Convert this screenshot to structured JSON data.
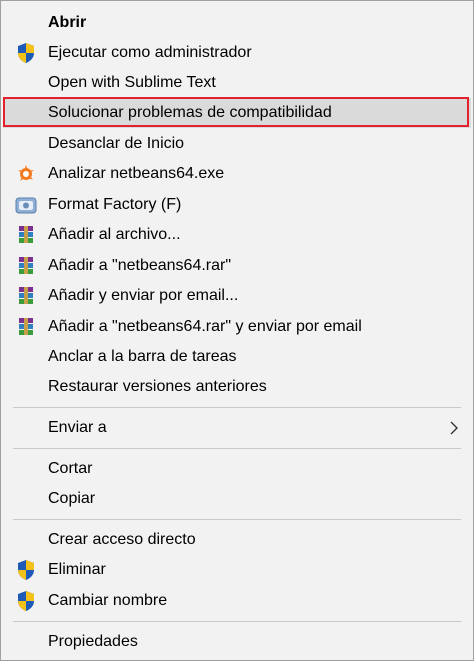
{
  "menu": {
    "items": [
      {
        "label": "Abrir",
        "icon": "none"
      },
      {
        "label": "Ejecutar como administrador",
        "icon": "shield-icon"
      },
      {
        "label": "Open with Sublime Text",
        "icon": "none"
      },
      {
        "label": "Solucionar problemas de compatibilidad",
        "icon": "none"
      },
      {
        "label": "Desanclar de Inicio",
        "icon": "none"
      },
      {
        "label": "Analizar netbeans64.exe",
        "icon": "avast-icon"
      },
      {
        "label": "Format Factory (F)",
        "icon": "format-factory-icon"
      },
      {
        "label": "Añadir al archivo...",
        "icon": "winrar-icon"
      },
      {
        "label": "Añadir a \"netbeans64.rar\"",
        "icon": "winrar-icon"
      },
      {
        "label": "Añadir y enviar por email...",
        "icon": "winrar-icon"
      },
      {
        "label": "Añadir a \"netbeans64.rar\" y enviar por email",
        "icon": "winrar-icon"
      },
      {
        "label": "Anclar a la barra de tareas",
        "icon": "none"
      },
      {
        "label": "Restaurar versiones anteriores",
        "icon": "none"
      },
      {
        "label": "Enviar a",
        "icon": "none",
        "submenu": "chevron-right-icon"
      },
      {
        "label": "Cortar",
        "icon": "none"
      },
      {
        "label": "Copiar",
        "icon": "none"
      },
      {
        "label": "Crear acceso directo",
        "icon": "none"
      },
      {
        "label": "Eliminar",
        "icon": "shield-icon"
      },
      {
        "label": "Cambiar nombre",
        "icon": "shield-icon"
      },
      {
        "label": "Propiedades",
        "icon": "none"
      }
    ]
  },
  "colors": {
    "menu_bg": "#f2f2f2",
    "hover_bg": "#dadada",
    "annotation_border": "#e3202c"
  }
}
